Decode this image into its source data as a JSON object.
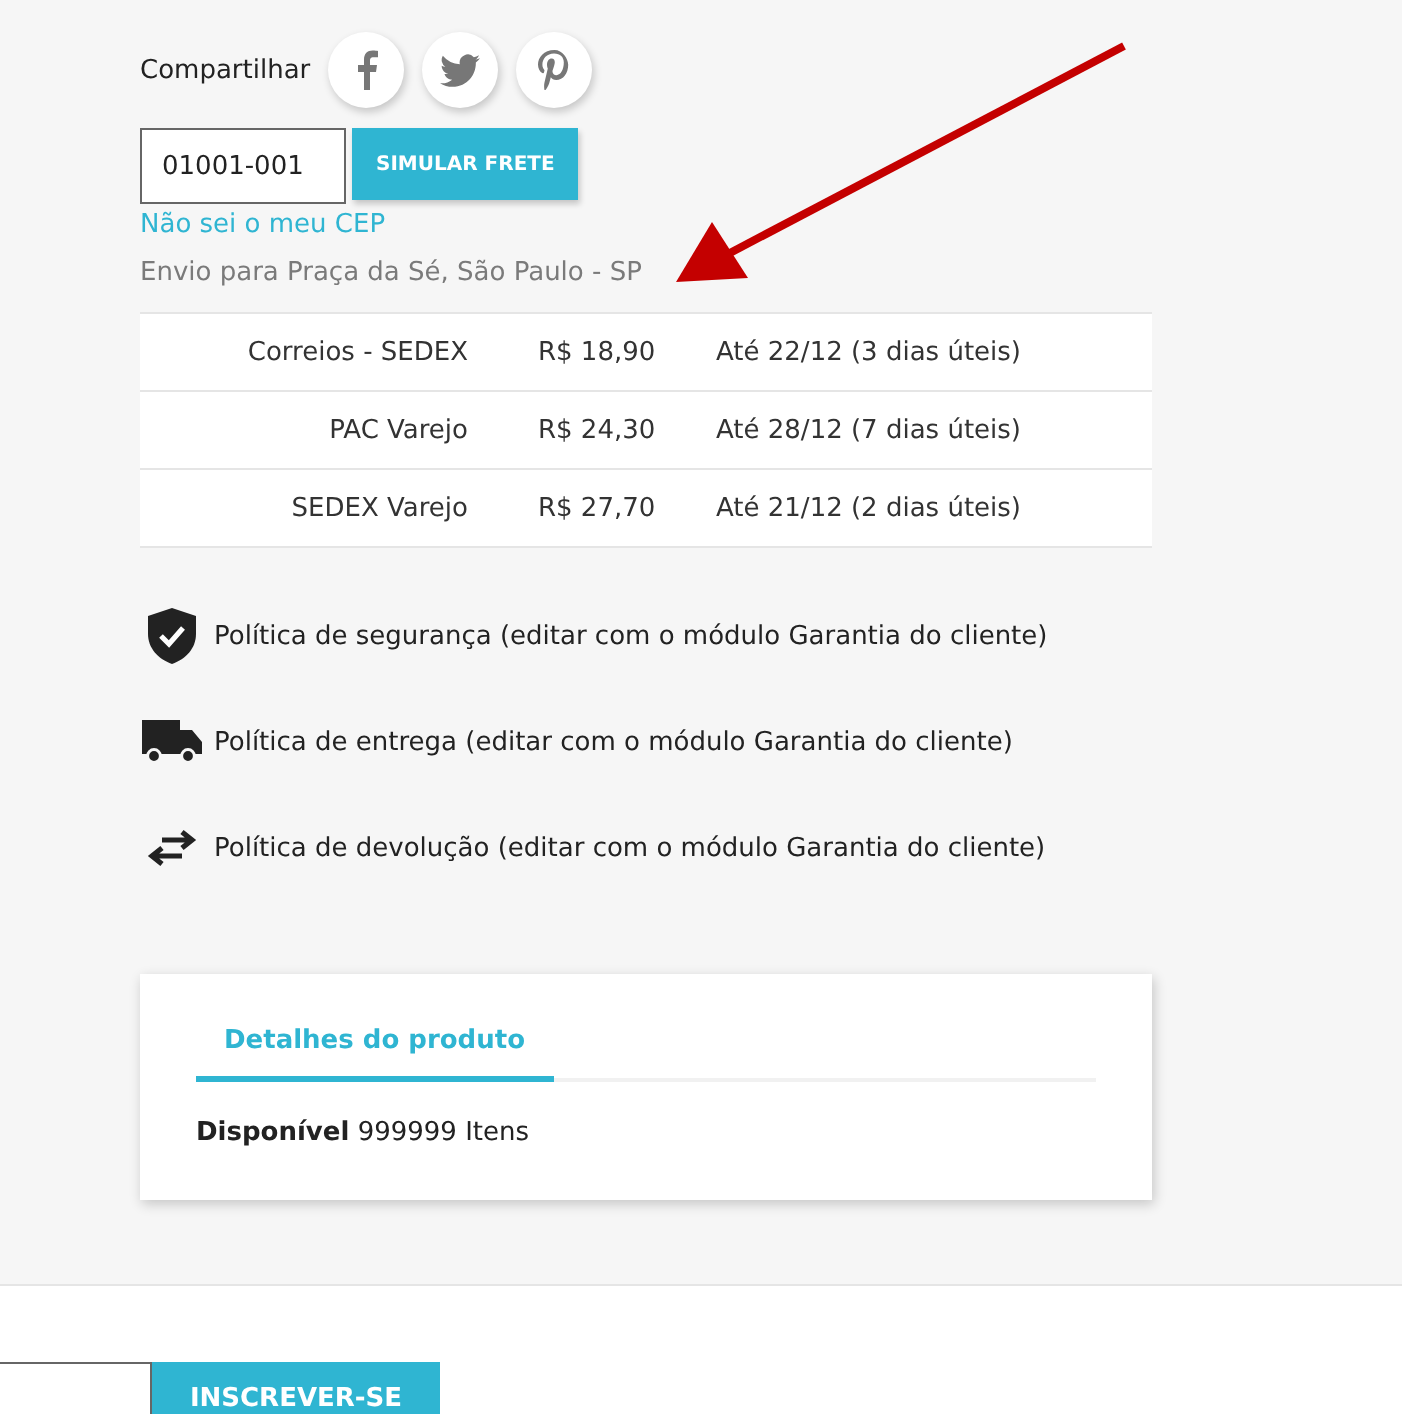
{
  "share": {
    "label": "Compartilhar",
    "networks": [
      {
        "kind": "facebook"
      },
      {
        "kind": "twitter"
      },
      {
        "kind": "pinterest"
      }
    ]
  },
  "shipping": {
    "cep_value": "01001-001",
    "button": "SIMULAR FRETE",
    "help_link": "Não sei o meu CEP",
    "destination": "Envio para Praça da Sé, São Paulo - SP"
  },
  "rates": [
    {
      "service": "Correios - SEDEX",
      "price": "R$ 18,90",
      "delivery": "Até 22/12 (3 dias úteis)"
    },
    {
      "service": "PAC Varejo",
      "price": "R$ 24,30",
      "delivery": "Até 28/12 (7 dias úteis)"
    },
    {
      "service": "SEDEX Varejo",
      "price": "R$ 27,70",
      "delivery": "Até 21/12 (2 dias úteis)"
    }
  ],
  "policies": [
    {
      "kind": "security",
      "text": "Política de segurança (editar com o módulo Garantia do cliente)"
    },
    {
      "kind": "delivery",
      "text": "Política de entrega (editar com o módulo Garantia do cliente)"
    },
    {
      "kind": "return",
      "text": "Política de devolução (editar com o módulo Garantia do cliente)"
    }
  ],
  "product_tabs": [
    {
      "label": "Detalhes do produto",
      "selected": true
    }
  ],
  "availability": "**Disponível** 999999 Itens",
  "newsletter": {
    "button": "INSCREVER-SE"
  }
}
